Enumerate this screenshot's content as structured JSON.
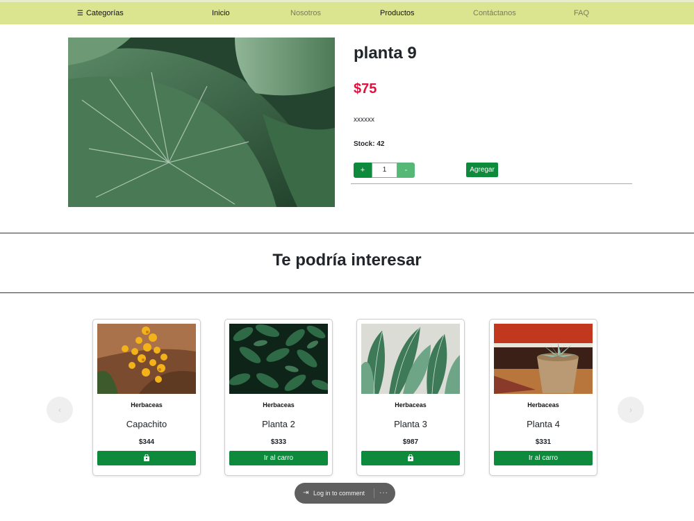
{
  "nav": {
    "categories_label": "Categorías",
    "items": [
      {
        "label": "Inicio"
      },
      {
        "label": "Nosotros"
      },
      {
        "label": "Productos"
      },
      {
        "label": "Contáctanos"
      },
      {
        "label": "FAQ"
      }
    ]
  },
  "product": {
    "title": "planta 9",
    "price": "$75",
    "description": "xxxxxx",
    "stock": "Stock: 42",
    "qty_plus": "+",
    "qty_value": "1",
    "qty_minus": "-",
    "add_label": "Agregar"
  },
  "related": {
    "title": "Te podría interesar",
    "prev_icon": "‹",
    "next_icon": "›",
    "cards": [
      {
        "category": "Herbaceas",
        "name": "Capachito",
        "price": "$344",
        "button": "",
        "button_icon": "shopping-bag-icon"
      },
      {
        "category": "Herbaceas",
        "name": "Planta 2",
        "price": "$333",
        "button": "Ir al carro"
      },
      {
        "category": "Herbaceas",
        "name": "Planta 3",
        "price": "$987",
        "button": "",
        "button_icon": "shopping-bag-icon"
      },
      {
        "category": "Herbaceas",
        "name": "Planta 4",
        "price": "$331",
        "button": "Ir al carro"
      }
    ]
  },
  "comment": {
    "login_label": "Log in to comment",
    "more": "···"
  },
  "colors": {
    "navbar": "#dbe590",
    "accent_green": "#0d8a3c",
    "light_green": "#55b877",
    "price_red": "#e0113d"
  }
}
